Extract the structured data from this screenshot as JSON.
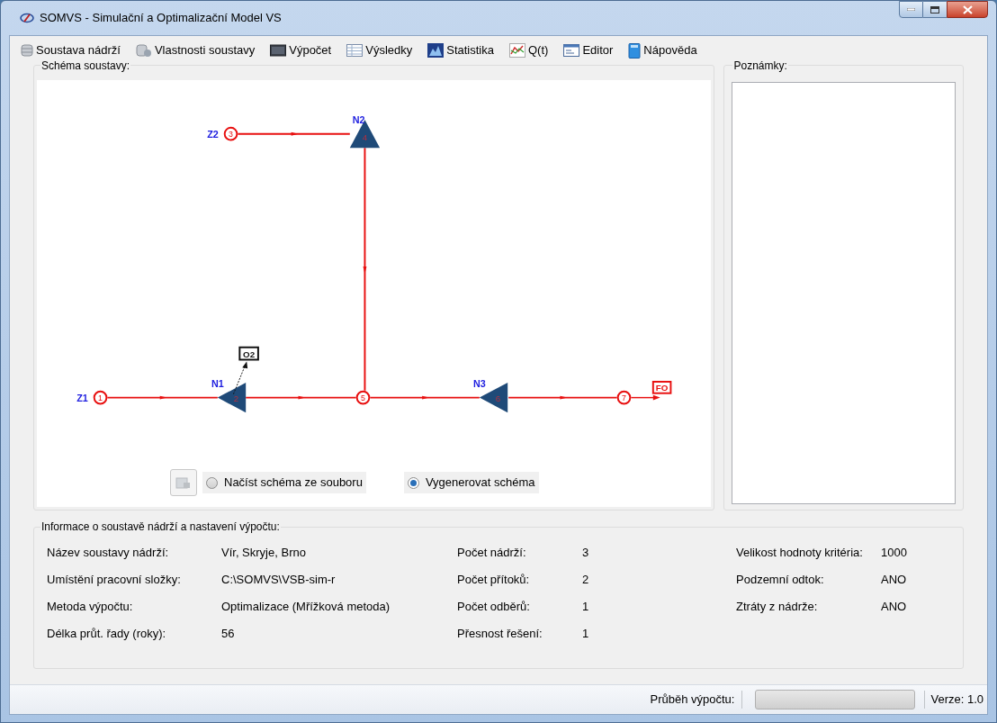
{
  "window": {
    "title": "SOMVS - Simulační a Optimalizační Model VS"
  },
  "menu": [
    {
      "label": "Soustava nádrží"
    },
    {
      "label": "Vlastnosti soustavy"
    },
    {
      "label": "Výpočet"
    },
    {
      "label": "Výsledky"
    },
    {
      "label": "Statistika"
    },
    {
      "label": "Q(t)"
    },
    {
      "label": "Editor"
    },
    {
      "label": "Nápověda"
    }
  ],
  "schema": {
    "title": "Schéma soustavy:",
    "nodes": [
      {
        "kind": "inflow",
        "label": "Z1",
        "number": "1"
      },
      {
        "kind": "reservoir",
        "label": "N1",
        "number": "2"
      },
      {
        "kind": "inflow",
        "label": "Z2",
        "number": "3"
      },
      {
        "kind": "reservoir",
        "label": "N2",
        "number": "4"
      },
      {
        "kind": "junction",
        "number": "5"
      },
      {
        "kind": "reservoir",
        "label": "N3",
        "number": "6"
      },
      {
        "kind": "junction",
        "number": "7"
      }
    ],
    "withdrawal": {
      "label": "O2"
    },
    "outflow": {
      "label": "FO"
    },
    "options": [
      {
        "label": "Načíst schéma ze souboru",
        "selected": false
      },
      {
        "label": "Vygenerovat schéma",
        "selected": true
      }
    ]
  },
  "notes": {
    "title": "Poznámky:"
  },
  "info": {
    "title": "Informace o soustavě nádrží a nastavení výpočtu:",
    "columns": [
      [
        {
          "label": "Název soustavy nádrží:",
          "value": "Vír, Skryje, Brno"
        },
        {
          "label": "Umístění pracovní složky:",
          "value": "C:\\SOMVS\\VSB-sim-r"
        },
        {
          "label": "Metoda výpočtu:",
          "value": "Optimalizace (Mřížková metoda)"
        },
        {
          "label": "Délka průt. řady (roky):",
          "value": "56"
        }
      ],
      [
        {
          "label": "Počet nádrží:",
          "value": "3"
        },
        {
          "label": "Počet přítoků:",
          "value": "2"
        },
        {
          "label": "Počet odběrů:",
          "value": "1"
        },
        {
          "label": "Přesnost řešení:",
          "value": "1"
        }
      ],
      [
        {
          "label": "Velikost hodnoty kritéria:",
          "value": "1000"
        },
        {
          "label": "Podzemní odtok:",
          "value": "ANO"
        },
        {
          "label": "Ztráty z nádrže:",
          "value": "ANO"
        }
      ]
    ]
  },
  "status_bar": {
    "progress_label": "Průběh výpočtu:",
    "progress": {
      "level": 0
    },
    "version": "Verze: 1.0"
  }
}
